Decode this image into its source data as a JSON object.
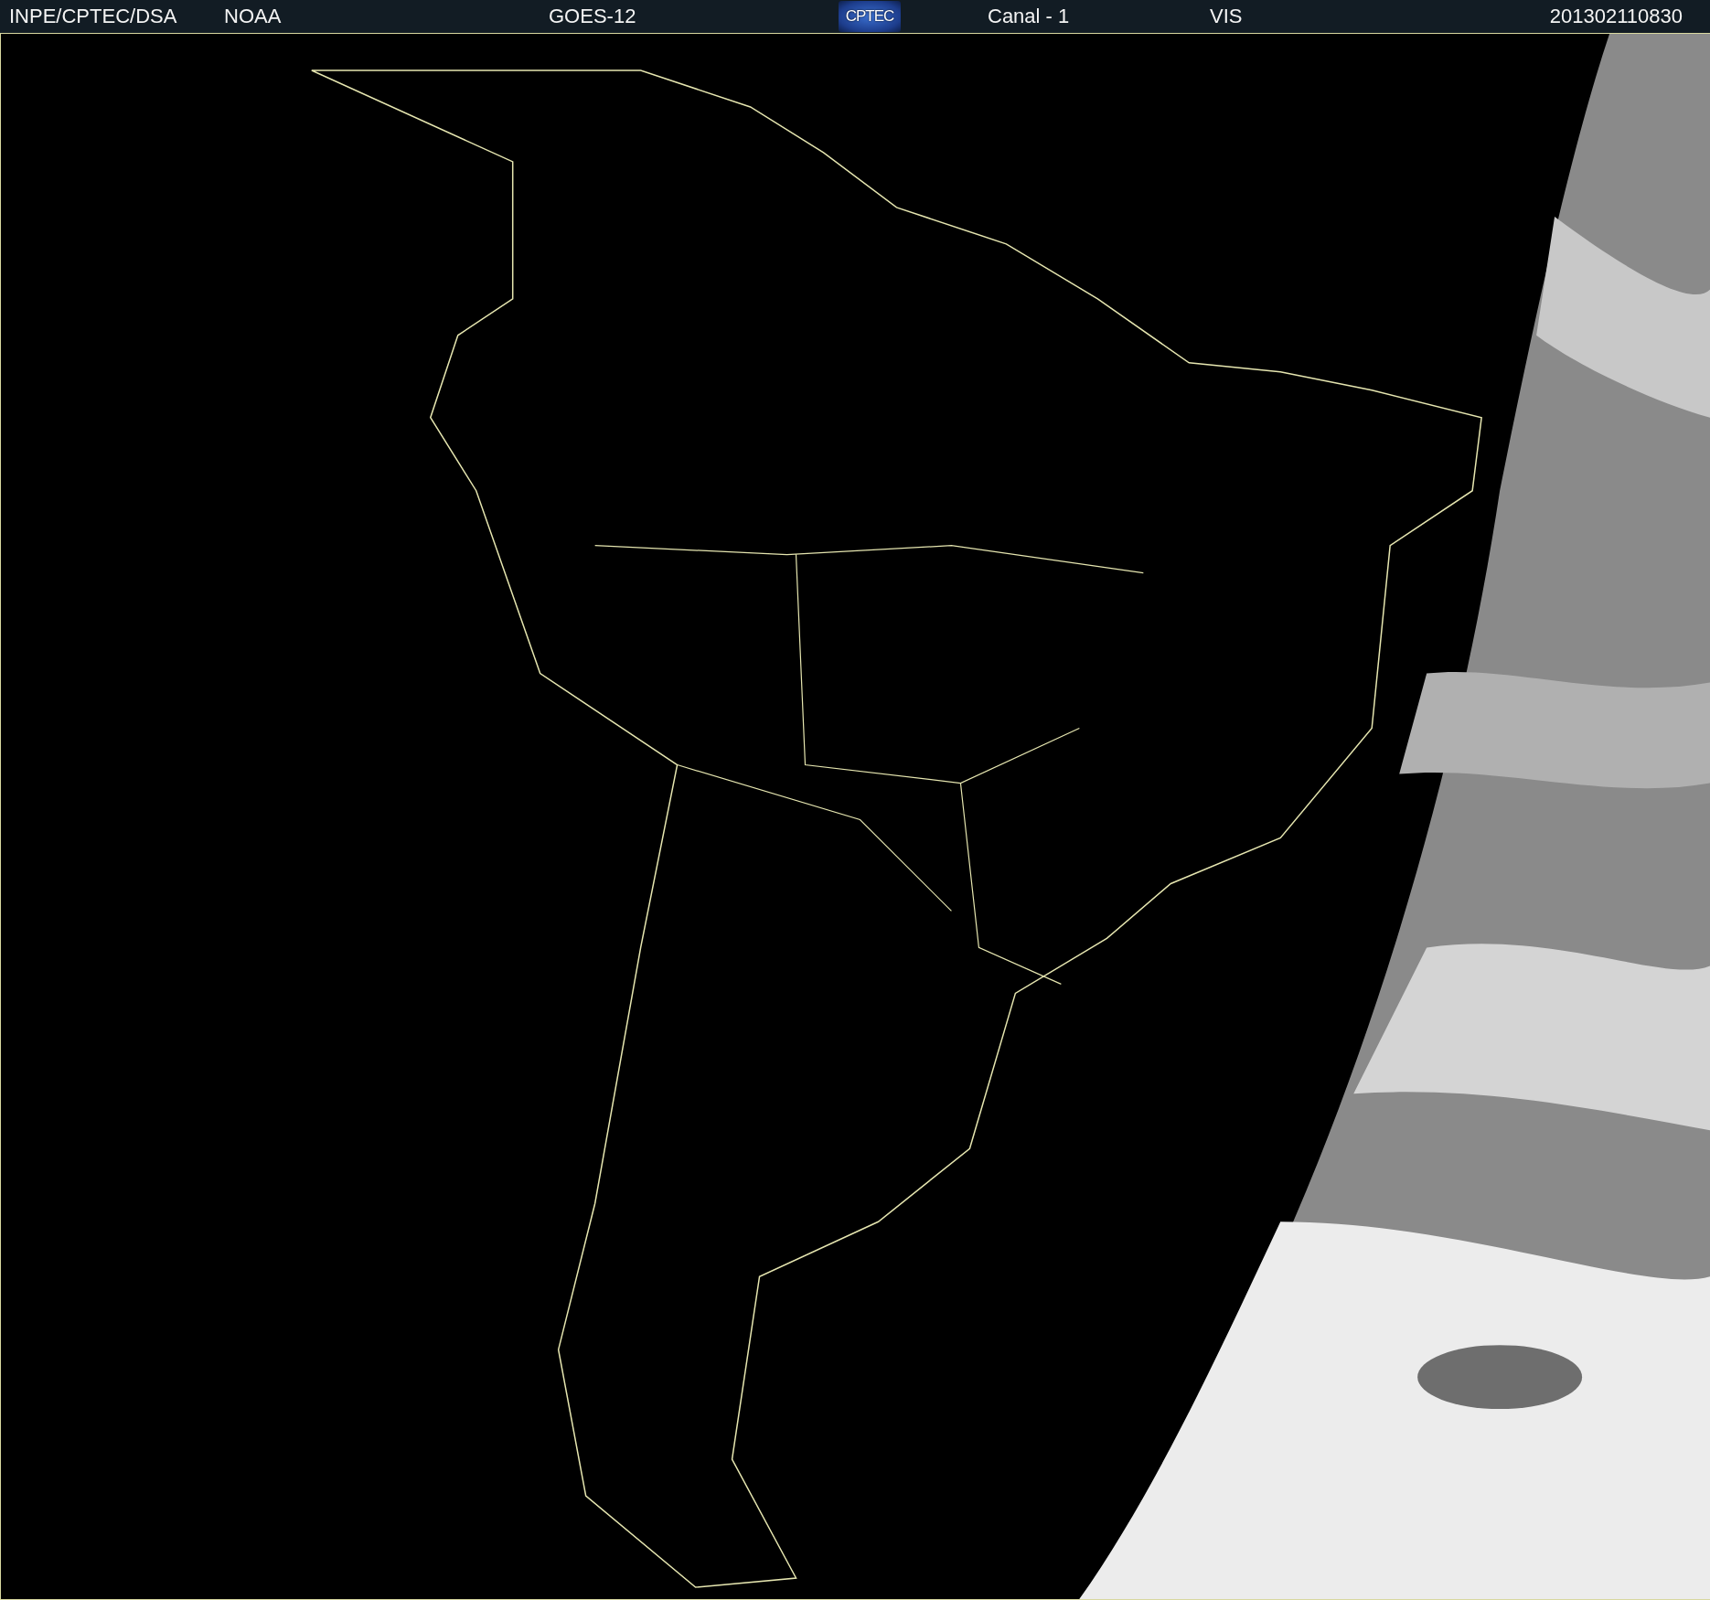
{
  "header": {
    "source": "INPE/CPTEC/DSA",
    "agency": "NOAA",
    "satellite": "GOES-12",
    "logo": "CPTEC",
    "channel": "Canal - 1",
    "band": "VIS",
    "timestamp": "201302110830"
  }
}
